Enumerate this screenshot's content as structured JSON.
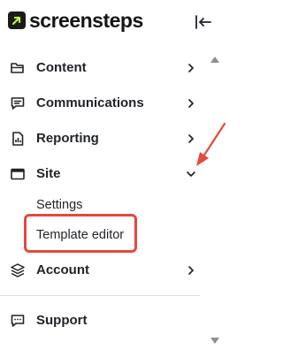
{
  "brand": {
    "name": "screensteps",
    "logo_icon": "screensteps-logo-icon"
  },
  "header": {
    "collapse_icon": "collapse-sidebar-icon"
  },
  "nav": {
    "items": [
      {
        "label": "Content",
        "icon": "folder-icon",
        "chevron": "chevron-right-icon"
      },
      {
        "label": "Communications",
        "icon": "message-icon",
        "chevron": "chevron-right-icon"
      },
      {
        "label": "Reporting",
        "icon": "report-icon",
        "chevron": "chevron-right-icon"
      },
      {
        "label": "Site",
        "icon": "browser-window-icon",
        "chevron": "chevron-down-icon",
        "expanded": true
      },
      {
        "label": "Account",
        "icon": "layers-icon",
        "chevron": "chevron-right-icon"
      },
      {
        "label": "Support",
        "icon": "support-icon"
      }
    ],
    "site_subitems": [
      {
        "label": "Settings"
      },
      {
        "label": "Template editor",
        "highlighted": true
      }
    ]
  },
  "colors": {
    "annotation": "#e5483e",
    "logo_accent": "#b7f34a",
    "text": "#1f2328"
  }
}
